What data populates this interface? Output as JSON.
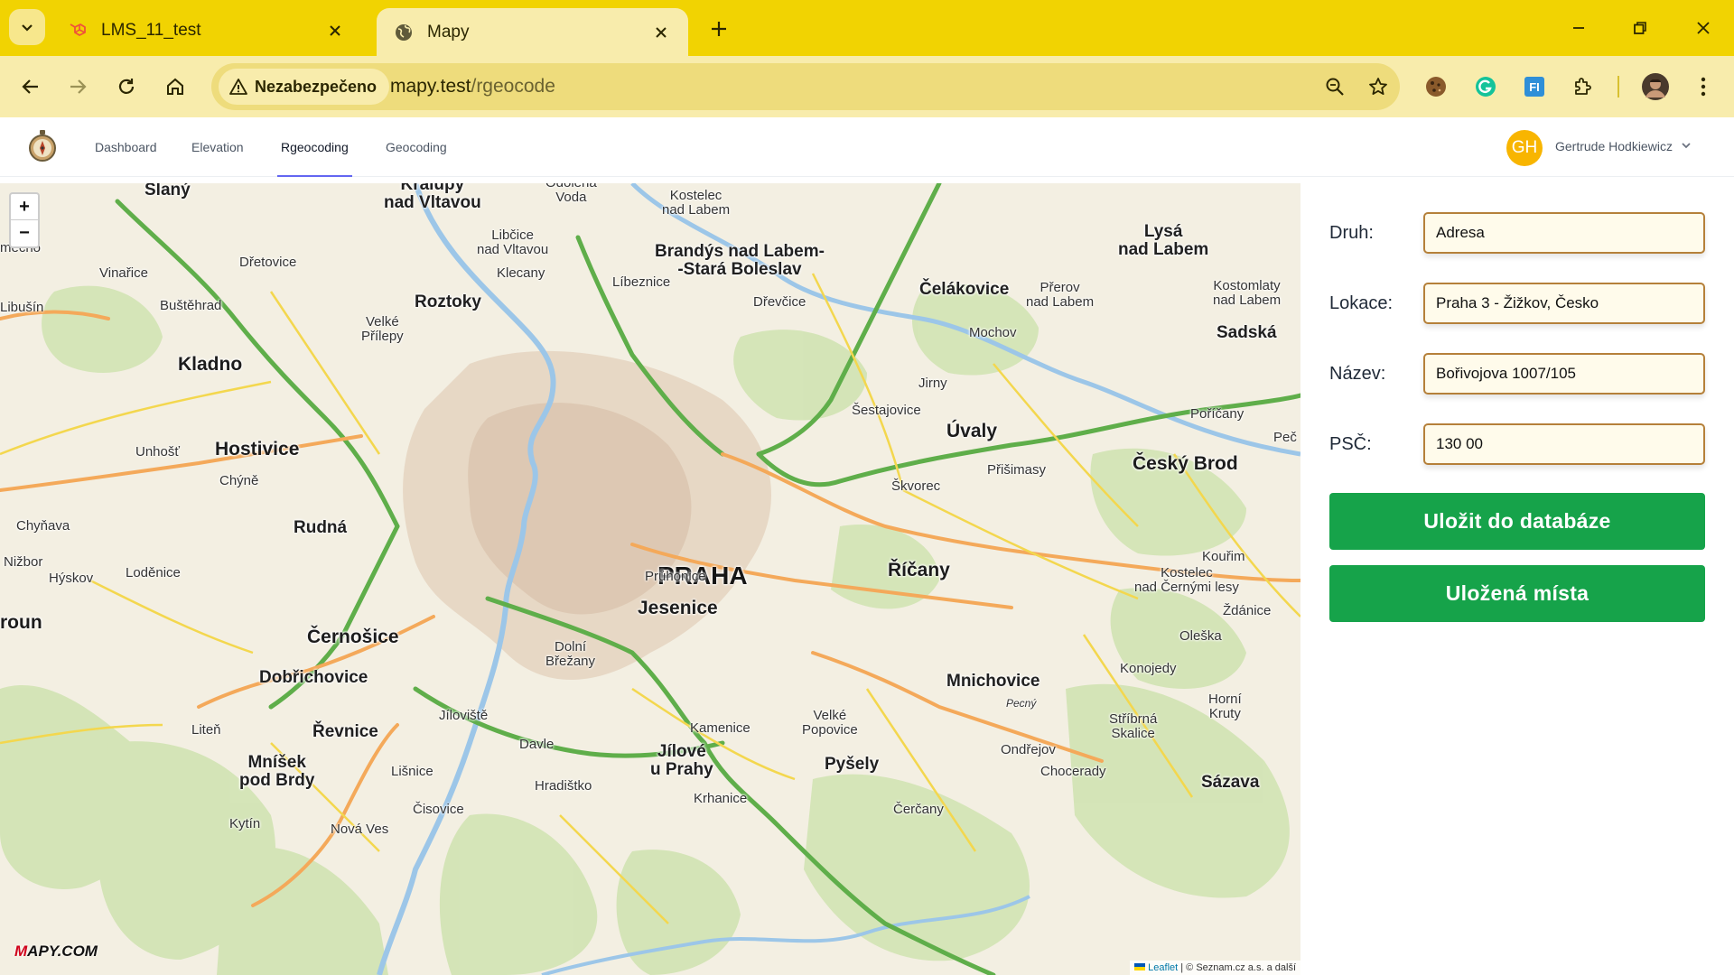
{
  "browser": {
    "tabs": [
      {
        "title": "LMS_11_test",
        "icon": "laravel-icon",
        "active": false
      },
      {
        "title": "Mapy",
        "icon": "globe-icon",
        "active": true
      }
    ],
    "security_label": "Nezabezpečeno",
    "url_host": "mapy.test",
    "url_path": "/rgeocode"
  },
  "navbar": {
    "links": [
      {
        "label": "Dashboard",
        "active": false
      },
      {
        "label": "Elevation",
        "active": false
      },
      {
        "label": "Rgeocoding",
        "active": true
      },
      {
        "label": "Geocoding",
        "active": false
      }
    ],
    "avatar_initials": "GH",
    "user_name": "Gertrude Hodkiewicz"
  },
  "map": {
    "zoom_in": "+",
    "zoom_out": "−",
    "logo": {
      "prefix": "M",
      "brand": "APY",
      "suffix": ".COM"
    },
    "attribution": {
      "leaflet": "Leaflet",
      "rest": " | © Seznam.cz a.s. a další"
    },
    "places": {
      "praha": "PRAHA",
      "slany": "Slaný",
      "kralupy_1": "Kralupy",
      "kralupy_2": "nad Vltavou",
      "odolena_1": "Odolena",
      "odolena_2": "Voda",
      "kostelec_l_1": "Kostelec",
      "kostelec_l_2": "nad Labem",
      "brandys_1": "Brandýs nad Labem-",
      "brandys_2": "-Stará Boleslav",
      "lysa_1": "Lysá",
      "lysa_2": "nad Labem",
      "libcice_1": "Libčice",
      "libcice_2": "nad Vltavou",
      "mecno": "mecno",
      "vinarice": "Vinařice",
      "dretovice": "Dřetovice",
      "libusin": "Libušín",
      "bustehrad": "Buštěhrad",
      "roztoky": "Roztoky",
      "klecany": "Klecany",
      "libeznice": "Líbeznice",
      "celakovice": "Čelákovice",
      "prerov_1": "Přerov",
      "prerov_2": "nad Labem",
      "kostelec_lab_1": "Kostomlaty",
      "kostelec_lab_2": "nad Labem",
      "drevcice": "Dřevčice",
      "kladno": "Kladno",
      "velke_prilepy_1": "Velké",
      "velke_prilepy_2": "Přílepy",
      "mochov": "Mochov",
      "sadska": "Sadská",
      "jirny": "Jirny",
      "sestajovice": "Šestajovice",
      "poricany": "Poříčany",
      "unhost": "Unhošť",
      "hostivice": "Hostivice",
      "uvaly": "Úvaly",
      "pec": "Peč",
      "chyne": "Chýně",
      "prisimasy": "Přišimasy",
      "cesky_brod": "Český Brod",
      "skvorec": "Škvorec",
      "chynava": "Chyňava",
      "rudna": "Rudná",
      "nizbor": "Nižbor",
      "hyskov": "Hýskov",
      "lodenice": "Loděnice",
      "pruhonice": "Průhonice",
      "ricany": "Říčany",
      "kourim": "Kouřim",
      "kostelec_c_1": "Kostelec",
      "kostelec_c_2": "nad Černými lesy",
      "zdanice": "Ždánice",
      "beroun": "roun",
      "jesenice": "Jesenice",
      "cernosice": "Černošice",
      "dolni_brezany_1": "Dolní",
      "dolni_brezany_2": "Břežany",
      "oleska": "Oleška",
      "konojedy": "Konojedy",
      "dobrichovice": "Dobřichovice",
      "mnichovice": "Mnichovice",
      "jiloviste": "Jíloviště",
      "liten": "Liteň",
      "revnice": "Řevnice",
      "velke_popovice_1": "Velké",
      "velke_popovice_2": "Popovice",
      "kamenice": "Kamenice",
      "strbrne_skalice_1": "Stříbrná",
      "strbrne_skalice_2": "Skalice",
      "horni_kruty_1": "Horní",
      "horni_kruty_2": "Kruty",
      "ondrejov": "Ondřejov",
      "mnisek_1": "Mníšek",
      "mnisek_2": "pod Brdy",
      "davle": "Davle",
      "jilove_1": "Jílové",
      "jilove_2": "u Prahy",
      "pysely": "Pyšely",
      "chocerady": "Chocerady",
      "lisnice": "Lišnice",
      "hradistko": "Hradištko",
      "krhanice": "Krhanice",
      "sazava": "Sázava",
      "cisovice": "Čisovice",
      "cercany": "Čerčany",
      "kytin": "Kytín",
      "nova_ves": "Nová Ves",
      "pecny": "Pecný"
    }
  },
  "form": {
    "fields": [
      {
        "label": "Druh:",
        "value": "Adresa"
      },
      {
        "label": "Lokace:",
        "value": "Praha 3 - Žižkov, Česko"
      },
      {
        "label": "Název:",
        "value": "Bořivojova 1007/105"
      },
      {
        "label": "PSČ:",
        "value": "130 00"
      }
    ],
    "save_button": "Uložit do databáze",
    "saved_button": "Uložená místa"
  },
  "colors": {
    "chrome": "#f1d302",
    "accent_nav": "#6366f1",
    "avatar": "#f8b500",
    "button": "#16a34a",
    "input_border": "#b5803a"
  }
}
